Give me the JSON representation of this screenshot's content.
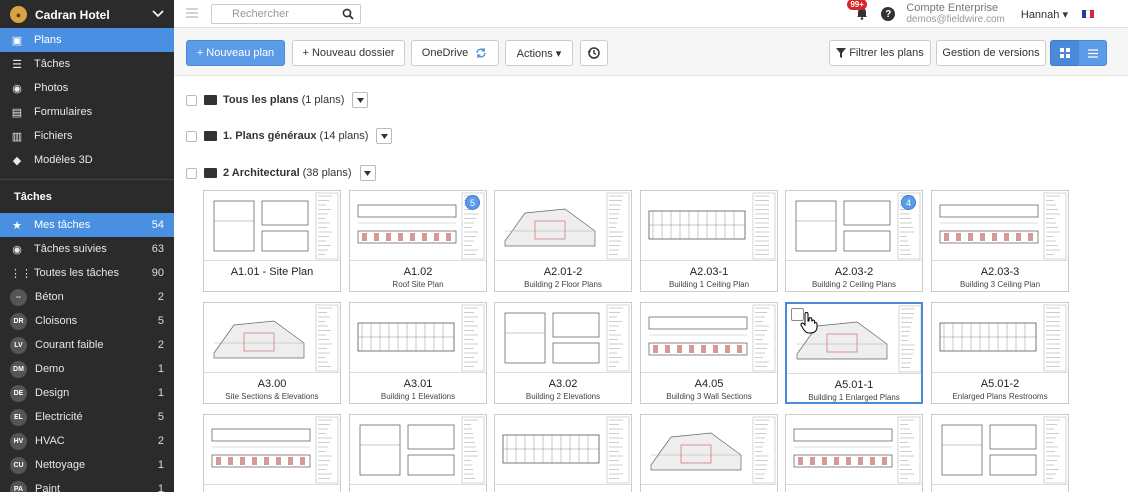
{
  "sidebar": {
    "project_name": "Cadran Hotel",
    "nav": [
      {
        "label": "Plans",
        "icon": "plans-icon"
      },
      {
        "label": "Tâches",
        "icon": "list-icon"
      },
      {
        "label": "Photos",
        "icon": "camera-icon"
      },
      {
        "label": "Formulaires",
        "icon": "form-icon"
      },
      {
        "label": "Fichiers",
        "icon": "files-icon"
      },
      {
        "label": "Modèles 3D",
        "icon": "cube-icon"
      }
    ],
    "tasks_title": "Tâches",
    "tasks": [
      {
        "label": "Mes tâches",
        "count": "54",
        "icon": "star-icon"
      },
      {
        "label": "Tâches suivies",
        "count": "63",
        "icon": "eye-icon"
      },
      {
        "label": "Toutes les tâches",
        "count": "90",
        "icon": "grid-icon"
      },
      {
        "label": "Béton",
        "count": "2",
        "badge": "--"
      },
      {
        "label": "Cloisons",
        "count": "5",
        "badge": "DR"
      },
      {
        "label": "Courant faible",
        "count": "2",
        "badge": "LV"
      },
      {
        "label": "Demo",
        "count": "1",
        "badge": "DM"
      },
      {
        "label": "Design",
        "count": "1",
        "badge": "DE"
      },
      {
        "label": "Electricité",
        "count": "5",
        "badge": "EL"
      },
      {
        "label": "HVAC",
        "count": "2",
        "badge": "HV"
      },
      {
        "label": "Nettoyage",
        "count": "1",
        "badge": "CU"
      },
      {
        "label": "Paint",
        "count": "1",
        "badge": "PA"
      }
    ]
  },
  "topbar": {
    "search_placeholder": "Rechercher",
    "notifications": "99+",
    "account_name": "Compte Enterprise",
    "account_email": "demos@fieldwire.com",
    "user": "Hannah ▾"
  },
  "toolbar": {
    "new_plan": "+ Nouveau plan",
    "new_folder": "+ Nouveau dossier",
    "onedrive": "OneDrive",
    "actions": "Actions ▾",
    "filter": "Filtrer les plans",
    "versions": "Gestion de versions"
  },
  "folders": [
    {
      "name": "Tous les plans",
      "count": "(1 plans)"
    },
    {
      "name": "1. Plans généraux",
      "count": "(14 plans)"
    },
    {
      "name": "2 Architectural",
      "count": "(38 plans)"
    }
  ],
  "plans": [
    {
      "code": "A1.01 - Site Plan",
      "name": ""
    },
    {
      "code": "A1.02",
      "name": "Roof Site Plan",
      "version": "5"
    },
    {
      "code": "A2.01-2",
      "name": "Building 2 Floor Plans"
    },
    {
      "code": "A2.03-1",
      "name": "Building 1 Ceiling Plan"
    },
    {
      "code": "A2.03-2",
      "name": "Building 2 Ceiling Plans",
      "version": "4"
    },
    {
      "code": "A2.03-3",
      "name": "Building 3 Ceiling Plan"
    },
    {
      "code": "A3.00",
      "name": "Site Sections & Elevations"
    },
    {
      "code": "A3.01",
      "name": "Building 1 Elevations"
    },
    {
      "code": "A3.02",
      "name": "Building 2 Elevations"
    },
    {
      "code": "A4.05",
      "name": "Building 3 Wall Sections"
    },
    {
      "code": "A5.01-1",
      "name": "Building 1 Enlarged Plans"
    },
    {
      "code": "A5.01-2",
      "name": "Enlarged Plans Restrooms"
    }
  ],
  "colors": {
    "accent": "#4a90e2",
    "sidebar_bg": "#2b2b2b"
  }
}
